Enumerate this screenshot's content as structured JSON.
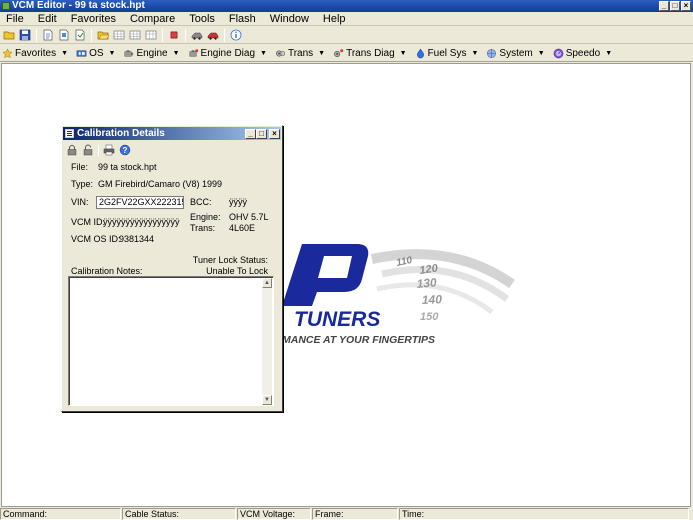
{
  "window": {
    "title": "VCM Editor - 99 ta stock.hpt",
    "min": "_",
    "max": "□",
    "close": "×"
  },
  "menu": [
    "File",
    "Edit",
    "Favorites",
    "Compare",
    "Tools",
    "Flash",
    "Window",
    "Help"
  ],
  "nav": [
    {
      "label": "Favorites",
      "icon": "star-icon"
    },
    {
      "label": "OS",
      "icon": "os-icon"
    },
    {
      "label": "Engine",
      "icon": "engine-icon"
    },
    {
      "label": "Engine Diag",
      "icon": "engine-diag-icon"
    },
    {
      "label": "Trans",
      "icon": "trans-icon"
    },
    {
      "label": "Trans Diag",
      "icon": "trans-diag-icon"
    },
    {
      "label": "Fuel Sys",
      "icon": "fuel-icon"
    },
    {
      "label": "System",
      "icon": "system-icon"
    },
    {
      "label": "Speedo",
      "icon": "speedo-icon"
    }
  ],
  "nav_arrow": "▼",
  "calibration": {
    "title": "Calibration Details",
    "file_label": "File:",
    "file_value": "99 ta stock.hpt",
    "type_label": "Type:",
    "type_value": "GM Firebird/Camaro (V8) 1999",
    "vin_label": "VIN:",
    "vin_value": "2G2FV22GXX2223158",
    "bcc_label": "BCC:",
    "bcc_value": "ÿÿÿÿ",
    "vcm_id_label": "VCM ID:",
    "vcm_id_value": "ÿÿÿÿÿÿÿÿÿÿÿÿÿÿÿÿÿ",
    "engine_label": "Engine:",
    "engine_value": "OHV 5.7L",
    "trans_label": "Trans:",
    "trans_value": "4L60E",
    "vcm_os_label": "VCM OS ID:",
    "vcm_os_value": "9381344",
    "tuner_lock_label": "Tuner Lock Status:",
    "tuner_lock_value": "Unable To Lock",
    "notes_label": "Calibration Notes:",
    "scroll_up": "▲",
    "scroll_down": "▼"
  },
  "logo": {
    "brand": "TUNERS",
    "tagline": "MANCE AT YOUR FINGERTIPS",
    "speedo_numbers": [
      "110",
      "120",
      "130",
      "140",
      "150"
    ]
  },
  "status": {
    "command": "Command:",
    "cable": "Cable Status:",
    "voltage": "VCM Voltage:",
    "frame": "Frame:",
    "time": "Time:"
  },
  "colors": {
    "logo_blue": "#1a2a9c",
    "accent_red": "#c0392b"
  }
}
